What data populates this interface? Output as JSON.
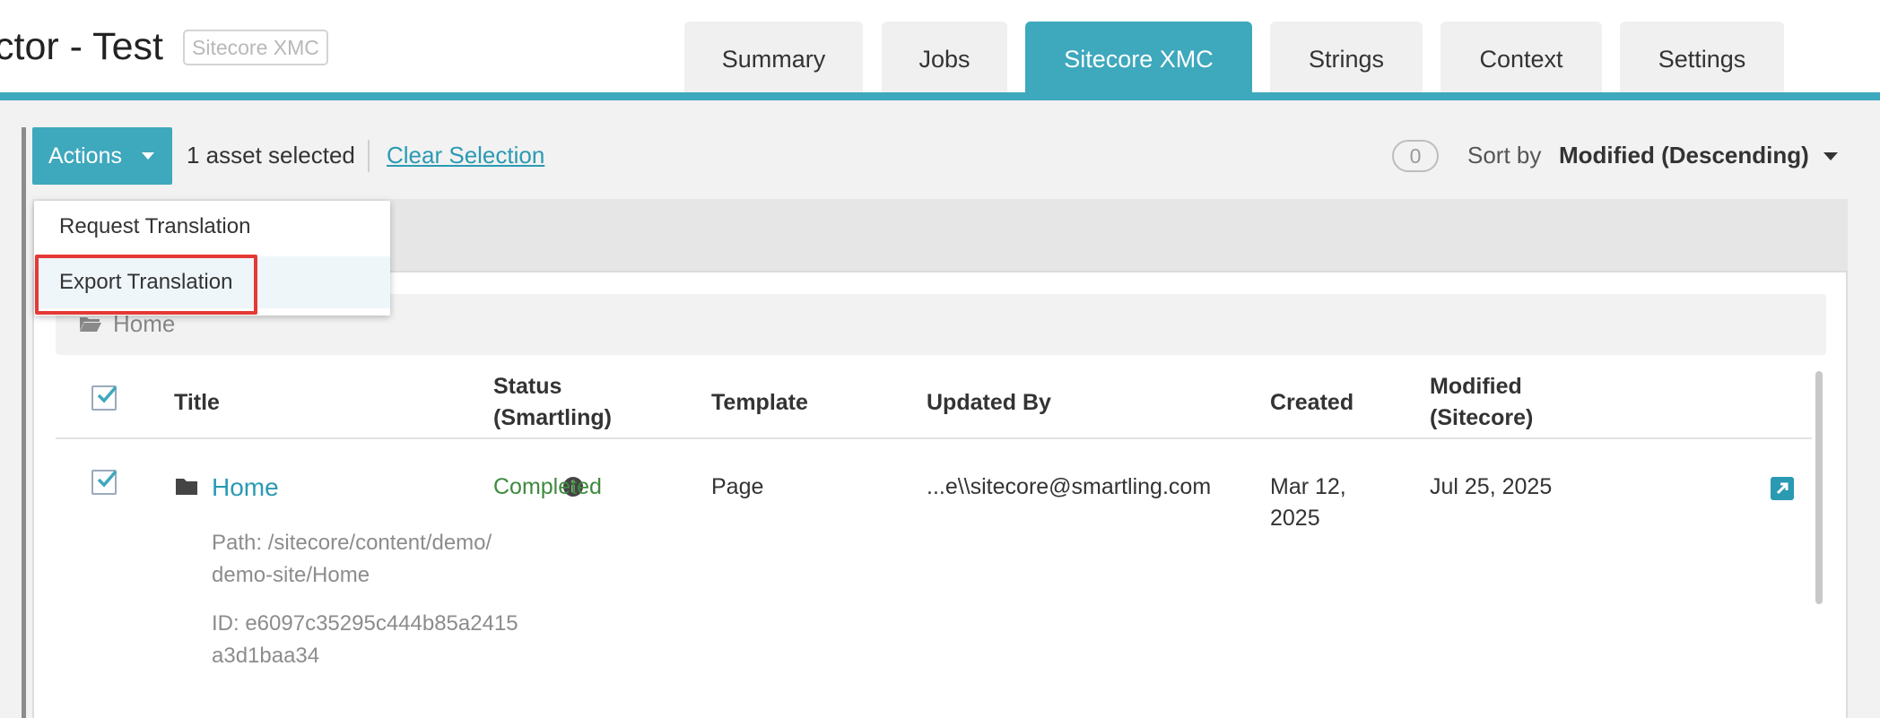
{
  "header": {
    "title": "ctor - Test",
    "badge": "Sitecore XMC",
    "tabs": [
      {
        "label": "Summary",
        "active": false
      },
      {
        "label": "Jobs",
        "active": false
      },
      {
        "label": "Sitecore XMC",
        "active": true
      },
      {
        "label": "Strings",
        "active": false
      },
      {
        "label": "Context",
        "active": false
      },
      {
        "label": "Settings",
        "active": false
      }
    ]
  },
  "toolbar": {
    "actions_label": "Actions",
    "selected_text": "1 asset selected",
    "clear_label": "Clear Selection",
    "count": "0",
    "sort_label": "Sort by",
    "sort_value": "Modified (Descending)"
  },
  "dropdown": {
    "items": [
      {
        "label": "Request Translation"
      },
      {
        "label": "Export Translation"
      }
    ]
  },
  "folder": {
    "name": "Home",
    "icon": "folder-open-icon"
  },
  "table": {
    "columns": {
      "title": "Title",
      "status_1": "Status",
      "status_2": "(Smartling)",
      "template": "Template",
      "updated_by": "Updated By",
      "created": "Created",
      "modified_1": "Modified",
      "modified_2": "(Sitecore)"
    },
    "rows": [
      {
        "title": "Home",
        "path_1": "Path: /sitecore/content/demo/",
        "path_2": "demo-site/Home",
        "id_1": "ID: e6097c35295c444b85a2415",
        "id_2": "a3d1baa34",
        "status": "Completed",
        "template": "Page",
        "updated_by": "...e\\\\sitecore@smartling.com",
        "created_1": "Mar 12,",
        "created_2": "2025",
        "modified": "Jul 25, 2025"
      }
    ]
  },
  "colors": {
    "accent": "#3ea8bd",
    "link": "#2a9ab3",
    "status_completed": "#3e8a3e",
    "highlight_border": "#e53935"
  }
}
